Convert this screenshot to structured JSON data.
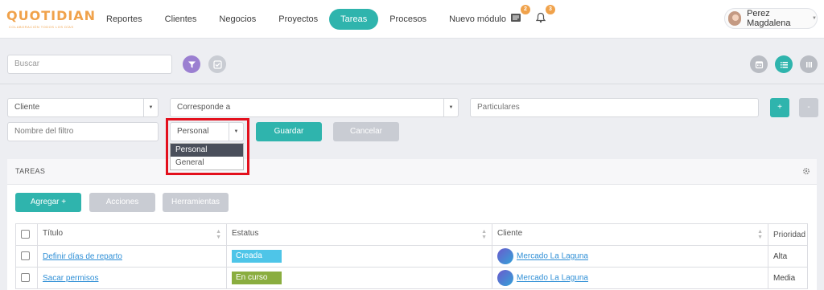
{
  "brand": {
    "name": "QUOTIDIAN",
    "tagline": "COLABORACIÓN TODOS LOS DÍAS",
    "accent": "#2fb4ad",
    "orange": "#f0a24b"
  },
  "nav": {
    "items": [
      "Reportes",
      "Clientes",
      "Negocios",
      "Proyectos",
      "Tareas",
      "Procesos",
      "Nuevo módulo"
    ],
    "active": "Tareas"
  },
  "header": {
    "messages_count": "2",
    "notifications_count": "3",
    "user_name": "Perez Magdalena"
  },
  "search": {
    "placeholder": "Buscar"
  },
  "filters": {
    "cliente": "Cliente",
    "corresponde": "Corresponde a",
    "particulares": "Particulares",
    "add_label": "+",
    "remove_label": "-",
    "nombre_placeholder": "Nombre del filtro",
    "tipo_selected": "Personal",
    "tipo_options": [
      "Personal",
      "General"
    ],
    "guardar": "Guardar",
    "cancelar": "Cancelar"
  },
  "panel": {
    "title": "TAREAS",
    "agregar": "Agregar +",
    "acciones": "Acciones",
    "herramientas": "Herramientas"
  },
  "table": {
    "columns": [
      "Título",
      "Estatus",
      "Cliente",
      "Prioridad"
    ],
    "rows": [
      {
        "titulo": "Definir días de reparto",
        "estatus": "Creada",
        "estatus_color": "#4ec5e8",
        "cliente": "Mercado La Laguna",
        "prioridad": "Alta"
      },
      {
        "titulo": "Sacar permisos",
        "estatus": "En curso",
        "estatus_color": "#8aad3f",
        "cliente": "Mercado La Laguna",
        "prioridad": "Media"
      }
    ]
  }
}
